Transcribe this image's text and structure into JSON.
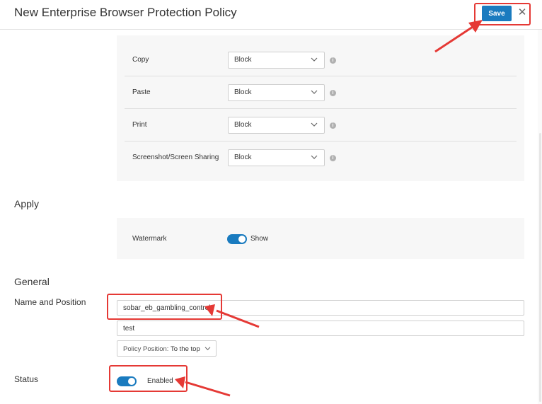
{
  "header": {
    "title": "New Enterprise Browser Protection Policy",
    "save_label": "Save",
    "close_glyph": "✕"
  },
  "protection_rows": [
    {
      "label": "Copy",
      "value": "Block"
    },
    {
      "label": "Paste",
      "value": "Block"
    },
    {
      "label": "Print",
      "value": "Block"
    },
    {
      "label": "Screenshot/Screen Sharing",
      "value": "Block"
    }
  ],
  "info_glyph": "i",
  "apply": {
    "heading": "Apply",
    "watermark_label": "Watermark",
    "watermark_toggle": "Show",
    "watermark_on": true
  },
  "general": {
    "heading": "General",
    "name_position_label": "Name and Position",
    "name_value": "sobar_eb_gambling_control",
    "description_value": "test",
    "policy_position_label": "Policy Position:",
    "policy_position_value": "To the top"
  },
  "status": {
    "label": "Status",
    "toggle_text": "Enabled",
    "enabled": true
  },
  "colors": {
    "accent": "#1a7bbf",
    "annotation": "#e53935"
  }
}
